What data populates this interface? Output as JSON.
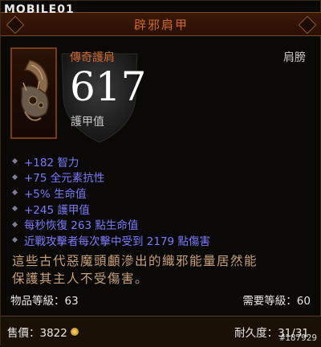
{
  "watermark": {
    "top": "MOBILE01",
    "bottom": "#187929"
  },
  "item": {
    "name": "辟邪肩甲",
    "rarity_type": "傳奇護肩",
    "slot": "肩膀",
    "armor": "617",
    "armor_label": "護甲值",
    "icon": "shoulder-armor-icon",
    "stats": [
      "+182 智力",
      "+75 全元素抗性",
      "+5% 生命值",
      "+245 護甲值",
      "每秒恢復 263 點生命值",
      "近戰攻擊者每次擊中受到 2179 點傷害"
    ],
    "flavor_line1": "這些古代惡魔頭顱滲出的織邪能量居然能",
    "flavor_line2": "保護其主人不受傷害。",
    "item_level": "物品等級：63",
    "required_level": "需要等級：60",
    "price": "售價：3822",
    "durability": "耐久度：31/31"
  },
  "colors": {
    "title": "#cc6a2c",
    "legendary": "#d06830",
    "magic_stat": "#7b7bff",
    "flavor": "#c8a27a",
    "gold": "#ffd86a"
  }
}
